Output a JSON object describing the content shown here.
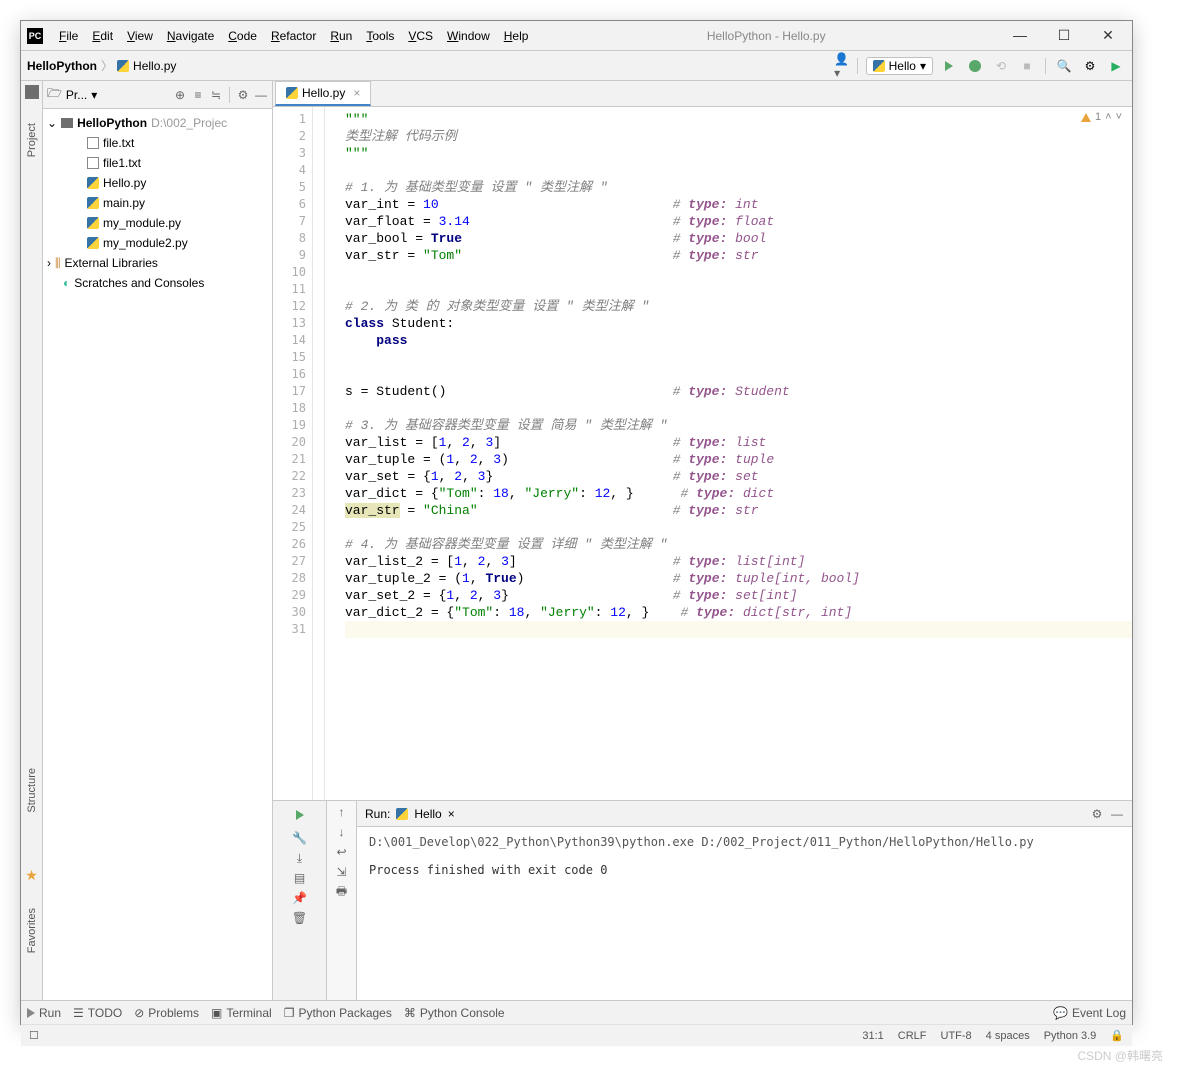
{
  "title": "HelloPython - Hello.py",
  "menu": [
    "File",
    "Edit",
    "View",
    "Navigate",
    "Code",
    "Refactor",
    "Run",
    "Tools",
    "VCS",
    "Window",
    "Help"
  ],
  "breadcrumb": {
    "project": "HelloPython",
    "file": "Hello.py"
  },
  "runconfig": "Hello",
  "project_panel_title": "Pr...",
  "tree": {
    "root": "HelloPython",
    "root_path": "D:\\002_Projec",
    "files": [
      "file.txt",
      "file1.txt",
      "Hello.py",
      "main.py",
      "my_module.py",
      "my_module2.py"
    ],
    "other": [
      "External Libraries",
      "Scratches and Consoles"
    ]
  },
  "tab": "Hello.py",
  "warn_count": "1",
  "code_lines": [
    {
      "n": 1,
      "html": "<span class='c-str'>\"\"\"</span>"
    },
    {
      "n": 2,
      "html": "<span class='c-com'>类型注解 代码示例</span>"
    },
    {
      "n": 3,
      "html": "<span class='c-str'>\"\"\"</span>"
    },
    {
      "n": 4,
      "html": ""
    },
    {
      "n": 5,
      "html": "<span class='c-com'># 1. 为 基础类型变量 设置 \" 类型注解 \"</span>"
    },
    {
      "n": 6,
      "html": "var_int = <span class='c-num'>10</span>                              <span class='c-com'># <span class='kw'>type:</span> <span class='c-type'>int</span></span>"
    },
    {
      "n": 7,
      "html": "var_float = <span class='c-num'>3.14</span>                          <span class='c-com'># <span class='kw'>type:</span> <span class='c-type'>float</span></span>"
    },
    {
      "n": 8,
      "html": "var_bool = <span class='c-kw'>True</span>                           <span class='c-com'># <span class='kw'>type:</span> <span class='c-type'>bool</span></span>"
    },
    {
      "n": 9,
      "html": "var_str = <span class='c-str'>\"Tom\"</span>                           <span class='c-com'># <span class='kw'>type:</span> <span class='c-type'>str</span></span>"
    },
    {
      "n": 10,
      "html": ""
    },
    {
      "n": 11,
      "html": ""
    },
    {
      "n": 12,
      "html": "<span class='c-com'># 2. 为 类 的 对象类型变量 设置 \" 类型注解 \"</span>"
    },
    {
      "n": 13,
      "html": "<span class='c-kw'>class</span> Student:"
    },
    {
      "n": 14,
      "html": "    <span class='c-kw'>pass</span>"
    },
    {
      "n": 15,
      "html": ""
    },
    {
      "n": 16,
      "html": ""
    },
    {
      "n": 17,
      "html": "s = Student()                             <span class='c-com'># <span class='kw'>type:</span> <span class='c-type'>Student</span></span>"
    },
    {
      "n": 18,
      "html": ""
    },
    {
      "n": 19,
      "html": "<span class='c-com'># 3. 为 基础容器类型变量 设置 简易 \" 类型注解 \"</span>"
    },
    {
      "n": 20,
      "html": "var_list = [<span class='c-num'>1</span>, <span class='c-num'>2</span>, <span class='c-num'>3</span>]                      <span class='c-com'># <span class='kw'>type:</span> <span class='c-type'>list</span></span>"
    },
    {
      "n": 21,
      "html": "var_tuple = (<span class='c-num'>1</span>, <span class='c-num'>2</span>, <span class='c-num'>3</span>)                     <span class='c-com'># <span class='kw'>type:</span> <span class='c-type'>tuple</span></span>"
    },
    {
      "n": 22,
      "html": "var_set = {<span class='c-num'>1</span>, <span class='c-num'>2</span>, <span class='c-num'>3</span>}                       <span class='c-com'># <span class='kw'>type:</span> <span class='c-type'>set</span></span>"
    },
    {
      "n": 23,
      "html": "var_dict = {<span class='c-str'>\"Tom\"</span>: <span class='c-num'>18</span>, <span class='c-str'>\"Jerry\"</span>: <span class='c-num'>12</span>, }      <span class='c-com'># <span class='kw'>type:</span> <span class='c-type'>dict</span></span>"
    },
    {
      "n": 24,
      "html": "<span class='hl'>var_str</span> = <span class='c-str'>\"China\"</span>                         <span class='c-com'># <span class='kw'>type:</span> <span class='c-type'>str</span></span>"
    },
    {
      "n": 25,
      "html": ""
    },
    {
      "n": 26,
      "html": "<span class='c-com'># 4. 为 基础容器类型变量 设置 详细 \" 类型注解 \"</span>"
    },
    {
      "n": 27,
      "html": "var_list_2 = [<span class='c-num'>1</span>, <span class='c-num'>2</span>, <span class='c-num'>3</span>]                    <span class='c-com'># <span class='kw'>type:</span> <span class='c-type'>list[int]</span></span>"
    },
    {
      "n": 28,
      "html": "var_tuple_2 = (<span class='c-num'>1</span>, <span class='c-kw'>True</span>)                   <span class='c-com'># <span class='kw'>type:</span> <span class='c-type'>tuple[int, bool]</span></span>"
    },
    {
      "n": 29,
      "html": "var_set_2 = {<span class='c-num'>1</span>, <span class='c-num'>2</span>, <span class='c-num'>3</span>}                     <span class='c-com'># <span class='kw'>type:</span> <span class='c-type'>set[int]</span></span>"
    },
    {
      "n": 30,
      "html": "var_dict_2 = {<span class='c-str'>\"Tom\"</span>: <span class='c-num'>18</span>, <span class='c-str'>\"Jerry\"</span>: <span class='c-num'>12</span>, }    <span class='c-com'># <span class='kw'>type:</span> <span class='c-type'>dict[str, int]</span></span>"
    },
    {
      "n": 31,
      "html": "",
      "cursor": true
    }
  ],
  "run": {
    "label": "Run:",
    "name": "Hello",
    "out_line1": "D:\\001_Develop\\022_Python\\Python39\\python.exe D:/002_Project/011_Python/HelloPython/Hello.py",
    "out_line2": "Process finished with exit code 0"
  },
  "bottom_tabs": [
    "Run",
    "TODO",
    "Problems",
    "Terminal",
    "Python Packages",
    "Python Console"
  ],
  "event_log": "Event Log",
  "status": {
    "pos": "31:1",
    "eol": "CRLF",
    "enc": "UTF-8",
    "indent": "4 spaces",
    "interp": "Python 3.9"
  },
  "left_tabs": [
    "Project",
    "Structure",
    "Favorites"
  ],
  "watermark": "CSDN @韩曙亮"
}
